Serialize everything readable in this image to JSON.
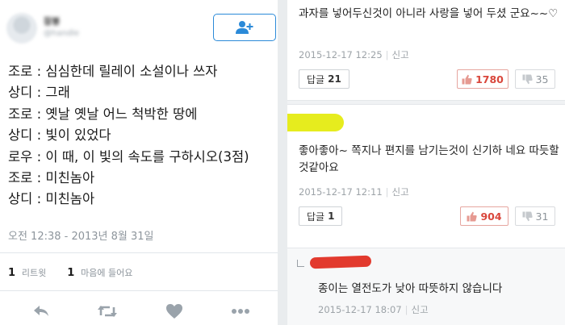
{
  "tweet": {
    "lines": [
      "조로 : 심심한데 릴레이 소설이나 쓰자",
      "상디 : 그래",
      "조로 : 옛날 옛날 어느 척박한 땅에",
      "상디 : 빛이 있었다",
      "로우 : 이 때, 이 빛의 속도를 구하시오(3점)",
      "조로 : 미친놈아",
      "상디 : 미친놈아"
    ],
    "timestamp": "오전 12:38 - 2013년 8월 31일",
    "retweets": {
      "count": "1",
      "label": "리트윗"
    },
    "likes": {
      "count": "1",
      "label": "마음에 들어요"
    },
    "icons": {
      "follow": "add-user-icon",
      "reply": "reply-icon",
      "retweet": "retweet-icon",
      "like": "heart-icon",
      "more": "more-icon"
    },
    "accent_color": "#2b8ad8"
  },
  "comments": [
    {
      "text": "과자를 넣어두신것이 아니라 사랑을 넣어 두셨 군요~~♡",
      "date": "2015-12-17 12:25",
      "report": "신고",
      "reply_label": "답글",
      "reply_count": "21",
      "likes": "1780",
      "dislikes": "35"
    },
    {
      "text": "좋아좋아~ 쪽지나 편지를 남기는것이 신기하 네요 따듯할것같아요",
      "date": "2015-12-17 12:11",
      "report": "신고",
      "reply_label": "답글",
      "reply_count": "1",
      "likes": "904",
      "dislikes": "31"
    }
  ],
  "reply": {
    "text": "종이는 열전도가 낮아 따뜻하지 않습니다",
    "date": "2015-12-17 18:07",
    "report": "신고"
  },
  "colors": {
    "like_red": "#d9463b",
    "highlight_yellow": "#e6ec1e",
    "redact_red": "#e23a2e"
  }
}
